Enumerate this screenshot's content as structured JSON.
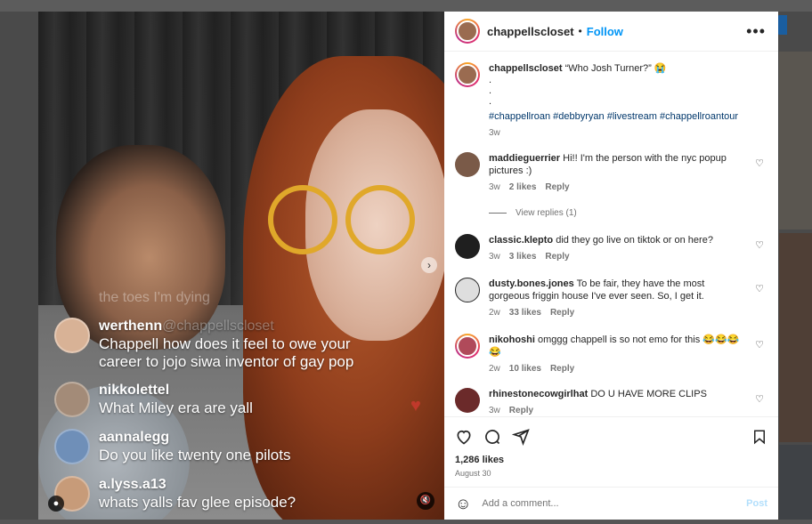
{
  "media": {
    "faded_text": "the toes I'm dying",
    "live_comments": [
      {
        "user": "werthenn",
        "ghost": "@chappellscloset",
        "message": "Chappell how does it feel to owe your career to jojo siwa inventor of gay pop"
      },
      {
        "user": "nikkolettel",
        "message": "What Miley era are yall"
      },
      {
        "user": "aannalegg",
        "message": "Do you like twenty one pilots"
      },
      {
        "user": "a.lyss.a13",
        "message": "whats yalls fav glee episode?"
      }
    ]
  },
  "post": {
    "author": "chappellscloset",
    "follow_label": "Follow",
    "more_label": "•••",
    "caption": {
      "user": "chappellscloset",
      "text": "“Who Josh Turner?” 😭",
      "dots": [
        ".",
        ".",
        "."
      ],
      "hashtags": "#chappellroan #debbyryan #livestream #chappellroantour",
      "time": "3w"
    },
    "comments": [
      {
        "user": "maddieguerrier",
        "text": "Hi!! I'm the person with the nyc popup pictures :)",
        "time": "3w",
        "likes": "2 likes",
        "reply": "Reply"
      },
      {
        "user": "classic.klepto",
        "text": "did they go live on tiktok or on here?",
        "time": "3w",
        "likes": "3 likes",
        "reply": "Reply"
      },
      {
        "user": "dusty.bones.jones",
        "text": "To be fair, they have the most gorgeous friggin house I've ever seen. So, I get it.",
        "time": "2w",
        "likes": "33 likes",
        "reply": "Reply"
      },
      {
        "user": "nikohoshi",
        "text": "omggg chappell is so not emo for this 😂😂😂😂",
        "time": "2w",
        "likes": "10 likes",
        "reply": "Reply"
      },
      {
        "user": "rhinestonecowgirlhat",
        "text": "DO U HAVE MORE CLIPS",
        "time": "3w",
        "reply": "Reply"
      }
    ],
    "view_replies": "View replies (1)",
    "likes_count": "1,286 likes",
    "date": "August 30",
    "comment_placeholder": "Add a comment...",
    "post_label": "Post"
  }
}
